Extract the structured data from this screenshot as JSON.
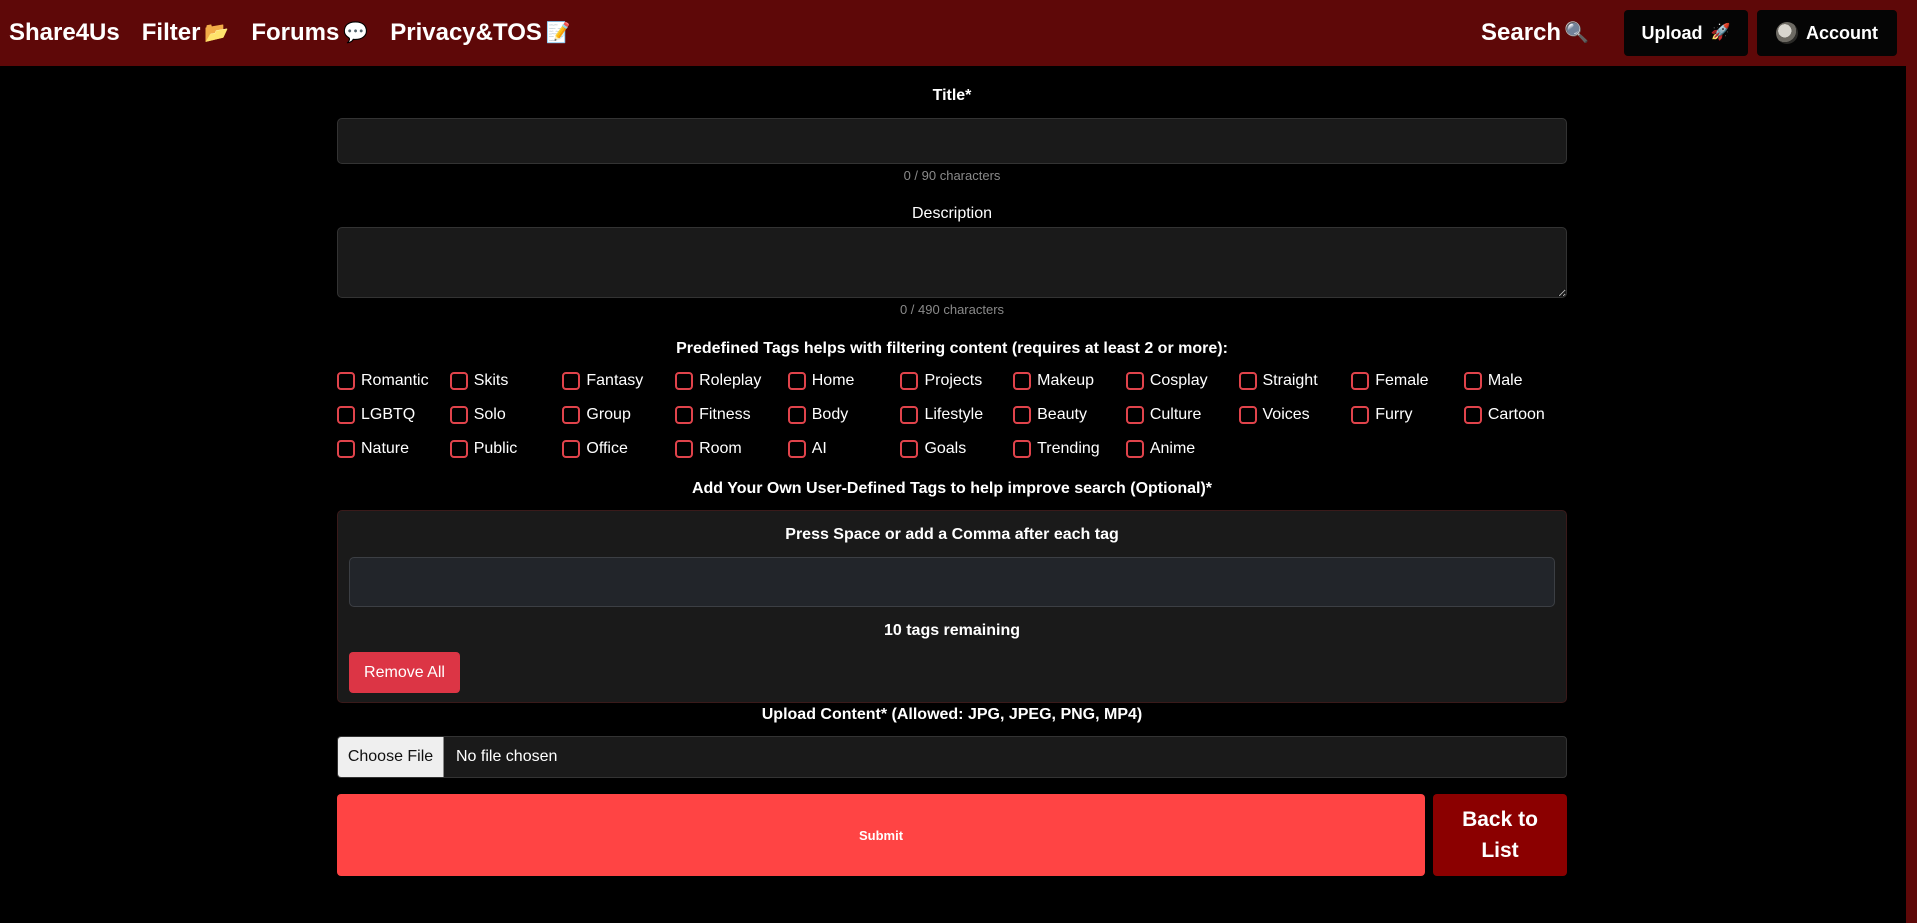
{
  "nav": {
    "brand": "Share4Us",
    "filter": "Filter",
    "filter_icon": "📂",
    "forums": "Forums",
    "forums_icon": "💬",
    "privacy": "Privacy&TOS",
    "privacy_icon": "📝",
    "search": "Search",
    "search_icon": "🔍",
    "upload": "Upload",
    "upload_icon": "🚀",
    "account": "Account"
  },
  "form": {
    "title_label": "Title*",
    "title_value": "",
    "title_counter": "0 / 90 characters",
    "description_label": "Description",
    "description_value": "",
    "description_counter": "0 / 490 characters",
    "tags_heading": "Predefined Tags helps with filtering content (requires at least 2 or more):",
    "tags": [
      "Romantic",
      "Skits",
      "Fantasy",
      "Roleplay",
      "Home",
      "Projects",
      "Makeup",
      "Cosplay",
      "Straight",
      "Female",
      "Male",
      "LGBTQ",
      "Solo",
      "Group",
      "Fitness",
      "Body",
      "Lifestyle",
      "Beauty",
      "Culture",
      "Voices",
      "Furry",
      "Cartoon",
      "Nature",
      "Public",
      "Office",
      "Room",
      "AI",
      "Goals",
      "Trending",
      "Anime"
    ],
    "custom_tags_heading": "Add Your Own User-Defined Tags to help improve search (Optional)*",
    "custom_tags_hint": "Press Space or add a Comma after each tag",
    "custom_tags_value": "",
    "tags_remaining": "10 tags remaining",
    "remove_all": "Remove All",
    "upload_label": "Upload Content* (Allowed: JPG, JPEG, PNG, MP4)",
    "choose_file": "Choose File",
    "file_status": "No file chosen",
    "submit": "Submit",
    "back_to_list": "Back to List"
  },
  "colors": {
    "navbar": "#5e0808",
    "page_bg": "#000000",
    "checkbox_border": "#e0434b",
    "remove_button": "#dc3545",
    "submit_button": "#ff4444",
    "back_button": "#8b0000"
  }
}
